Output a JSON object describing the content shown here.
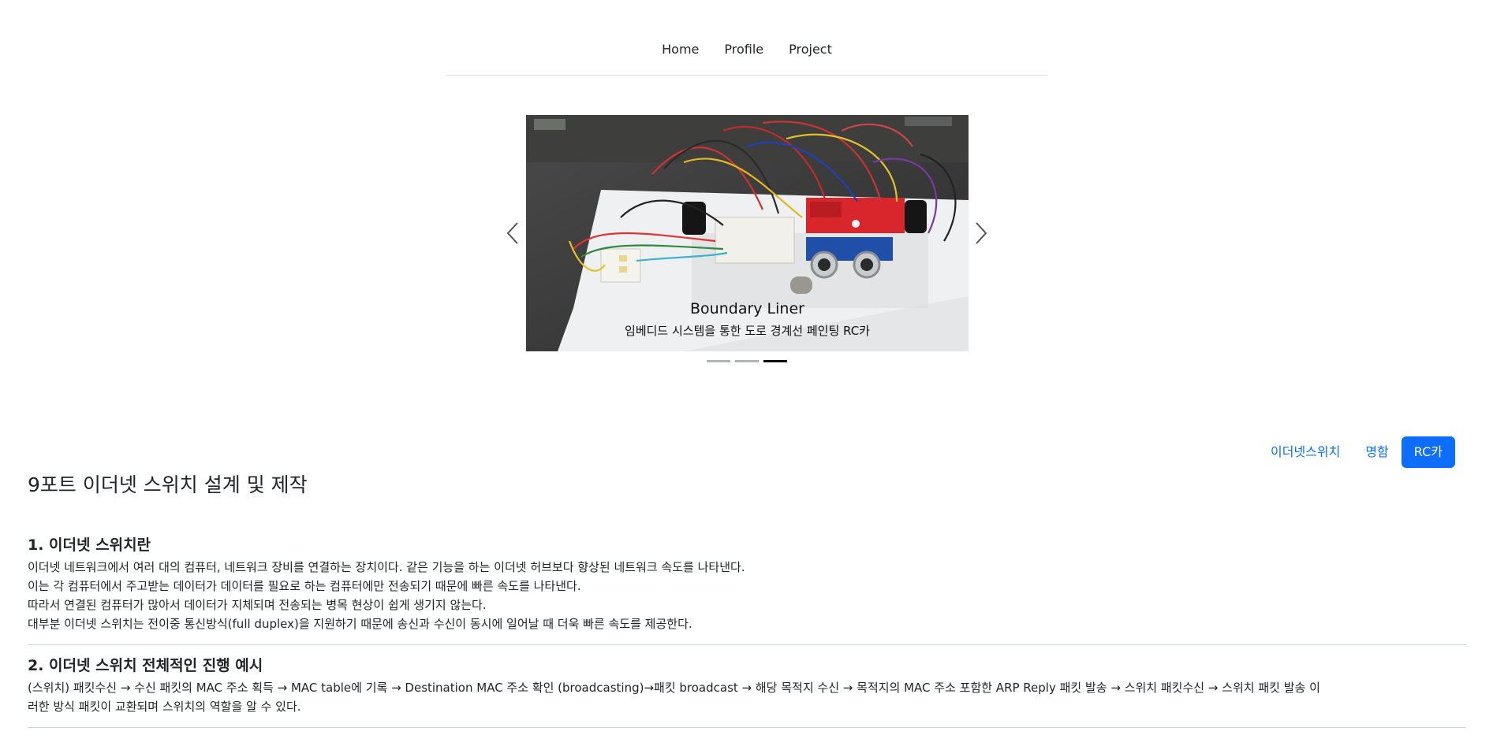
{
  "nav": {
    "items": [
      "Home",
      "Profile",
      "Project"
    ]
  },
  "carousel": {
    "title": "Boundary Liner",
    "subtitle": "임베디드 시스템을 통한 도로 경계선 페인팅 RC카",
    "prev_icon": "chevron-left-icon",
    "next_icon": "chevron-right-icon",
    "slide_count": 3,
    "active_index": 2
  },
  "tabs": {
    "items": [
      "이더넷스위치",
      "명함",
      "RC카"
    ],
    "active_index": 2,
    "accent": "#0d6efd"
  },
  "main": {
    "title": "9포트 이더넷 스위치 설계 및 제작",
    "sections": [
      {
        "heading": "1. 이더넷 스위치란",
        "lines": [
          "이더넷 네트워크에서 여러 대의 컴퓨터, 네트워크 장비를 연결하는 장치이다. 같은 기능을 하는 이더넷 허브보다 향상된 네트워크 속도를 나타낸다.",
          "이는 각 컴퓨터에서 주고받는 데이터가 데이터를 필요로 하는 컴퓨터에만 전송되기 때문에 빠른 속도를 나타낸다.",
          "따라서 연결된 컴퓨터가 많아서 데이터가 지체되며 전송되는 병목 현상이 쉽게 생기지 않는다.",
          "대부분 이더넷 스위치는 전이중 통신방식(full duplex)을 지원하기 때문에 송신과 수신이 동시에 일어날 때 더욱 빠른 속도를 제공한다."
        ]
      },
      {
        "heading": "2. 이더넷 스위치 전체적인 진행 예시",
        "lines": [
          "(스위치) 패킷수신 → 수신 패킷의 MAC 주소 획득 → MAC table에 기록 → Destination MAC 주소 확인 (broadcasting)→패킷 broadcast → 해당 목적지 수신 → 목적지의 MAC 주소 포함한 ARP Reply 패킷 발송 → 스위치 패킷수신 → 스위치 패킷 발송 이",
          "러한 방식 패킷이 교환되며 스위치의 역할을 알 수 있다."
        ]
      }
    ]
  }
}
